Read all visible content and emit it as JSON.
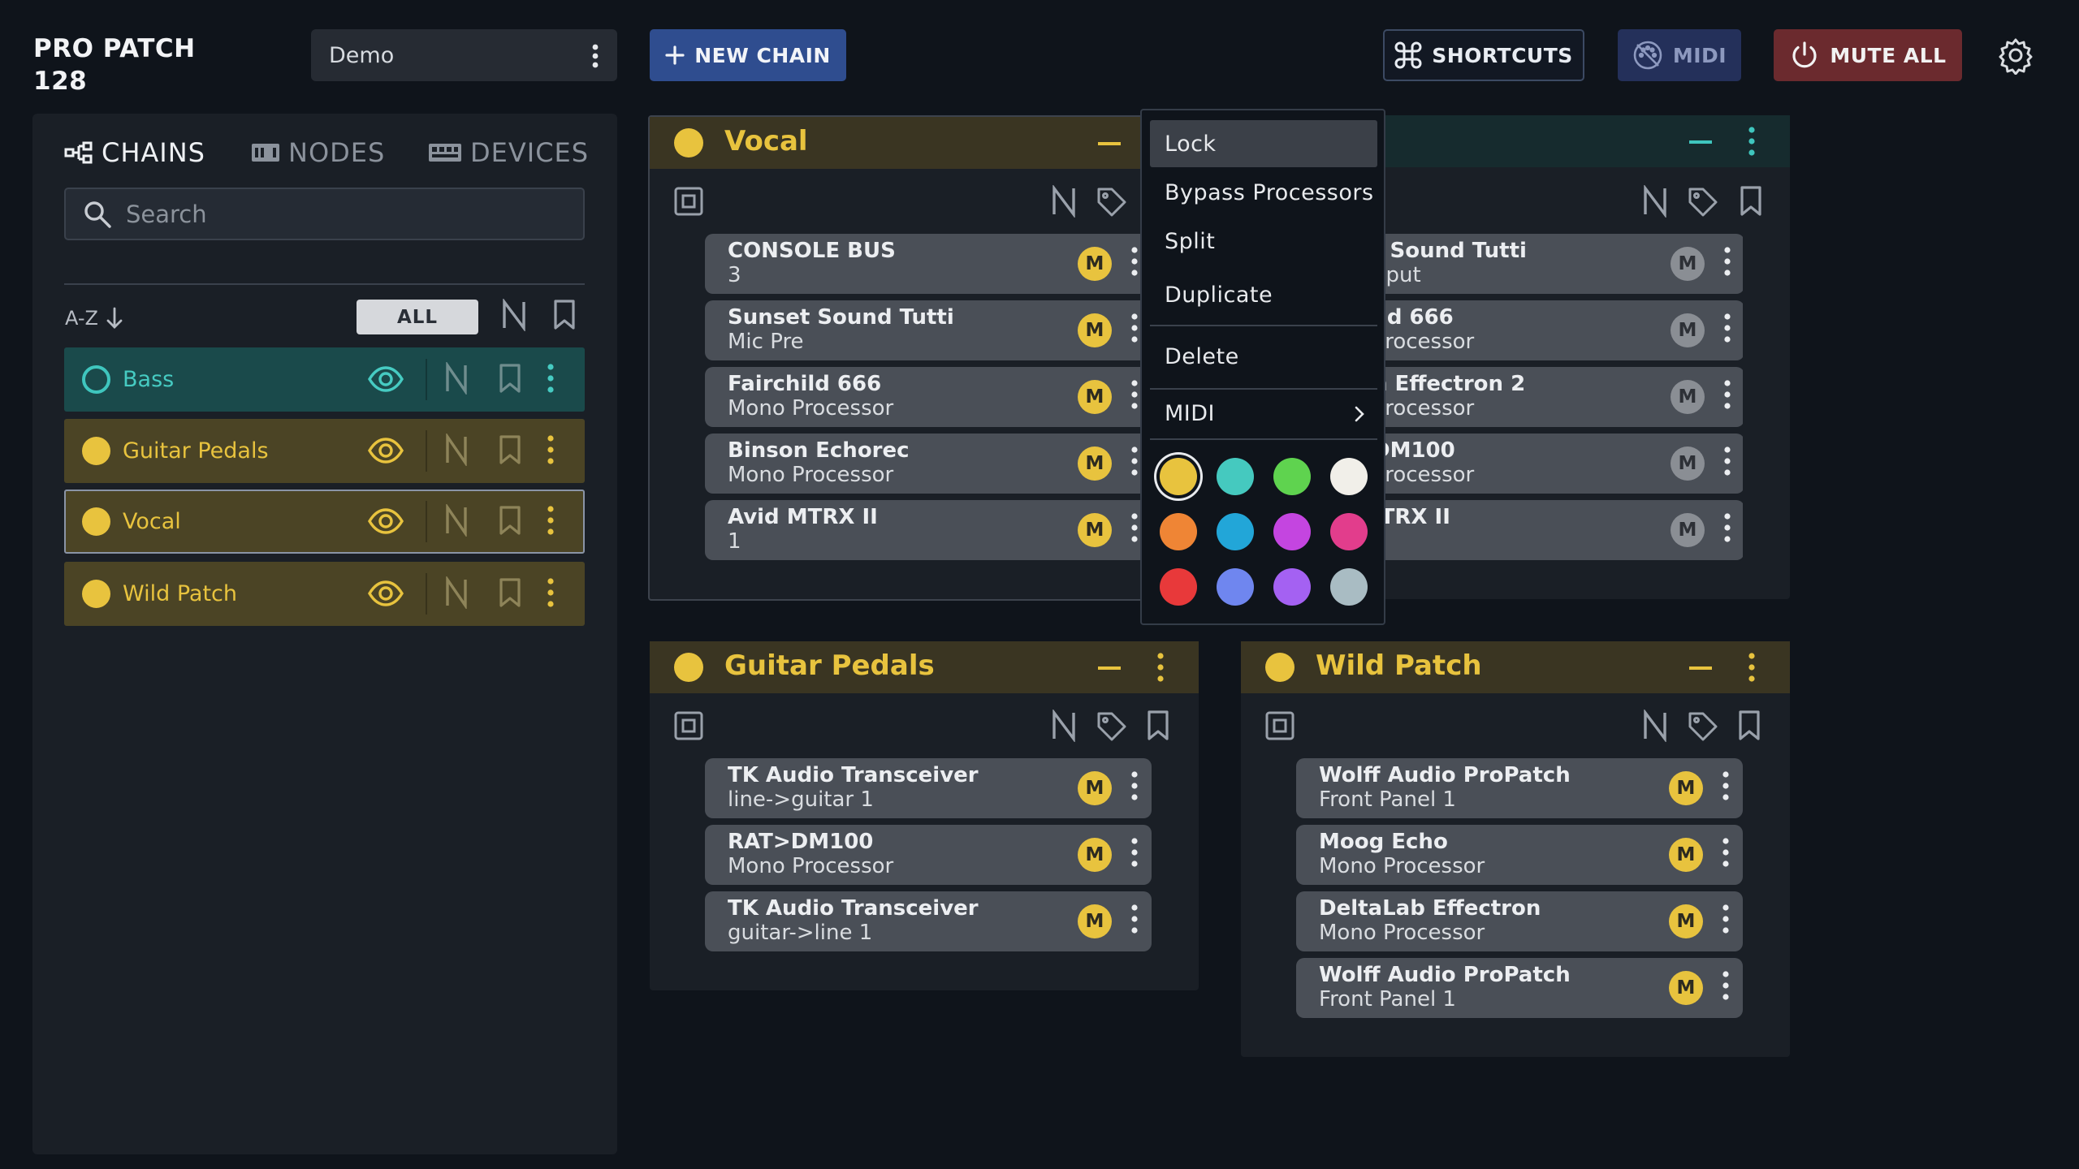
{
  "app": {
    "title": "PRO PATCH 128",
    "title_line1": "PRO PATCH",
    "title_line2": "128"
  },
  "header": {
    "project": "Demo",
    "new_chain": "NEW CHAIN",
    "shortcuts": "SHORTCUTS",
    "midi": "MIDI",
    "mute_all": "MUTE ALL"
  },
  "sidebar": {
    "tabs": [
      {
        "label": "CHAINS",
        "active": true
      },
      {
        "label": "NODES",
        "active": false
      },
      {
        "label": "DEVICES",
        "active": false
      }
    ],
    "search_placeholder": "Search",
    "sort_label": "A-Z",
    "filter_all": "ALL",
    "chains": [
      {
        "name": "Bass",
        "color": "#3fc6be",
        "style": "teal",
        "dot": "ring"
      },
      {
        "name": "Guitar Pedals",
        "color": "#e8c33e",
        "style": "gold"
      },
      {
        "name": "Vocal",
        "color": "#e8c33e",
        "style": "gold",
        "selected": true
      },
      {
        "name": "Wild Patch",
        "color": "#e8c33e",
        "style": "gold"
      }
    ]
  },
  "panels": {
    "vocal": {
      "title": "Vocal",
      "nodes": [
        {
          "name": "CONSOLE BUS",
          "sub": "3",
          "badge": "M"
        },
        {
          "name": "Sunset Sound Tutti",
          "sub": "Mic Pre",
          "badge": "M"
        },
        {
          "name": "Fairchild 666",
          "sub": "Mono Processor",
          "badge": "M"
        },
        {
          "name": "Binson Echorec",
          "sub": "Mono Processor",
          "badge": "M"
        },
        {
          "name": "Avid MTRX II",
          "sub": "1",
          "badge": "M"
        }
      ]
    },
    "bass": {
      "nodes": [
        {
          "name": "t Sound Tutti",
          "sub": "nput",
          "badge": "M"
        },
        {
          "name": "ild 666",
          "sub": "Processor",
          "badge": "M"
        },
        {
          "name": "n Effectron 2",
          "sub": "Processor",
          "badge": "M"
        },
        {
          "name": "DM100",
          "sub": "Processor",
          "badge": "M"
        },
        {
          "name": "ITRX II",
          "sub": "",
          "badge": "M"
        }
      ]
    },
    "guitar": {
      "title": "Guitar Pedals",
      "nodes": [
        {
          "name": "TK Audio Transceiver",
          "sub": "line->guitar 1",
          "badge": "M"
        },
        {
          "name": "RAT>DM100",
          "sub": "Mono Processor",
          "badge": "M"
        },
        {
          "name": "TK Audio Transceiver",
          "sub": "guitar->line 1",
          "badge": "M"
        }
      ]
    },
    "wild": {
      "title": "Wild Patch",
      "nodes": [
        {
          "name": "Wolff Audio ProPatch",
          "sub": "Front Panel 1",
          "badge": "M"
        },
        {
          "name": "Moog Echo",
          "sub": "Mono Processor",
          "badge": "M"
        },
        {
          "name": "DeltaLab Effectron",
          "sub": "Mono Processor",
          "badge": "M"
        },
        {
          "name": "Wolff Audio ProPatch",
          "sub": "Front Panel 1",
          "badge": "M"
        }
      ]
    }
  },
  "context_menu": {
    "items": [
      "Lock",
      "Bypass Processors",
      "Split",
      "Duplicate",
      "Delete",
      "MIDI"
    ],
    "swatches": [
      "#e8c33e",
      "#45c9bf",
      "#5fd34f",
      "#f1efe9",
      "#ef8535",
      "#22a6d8",
      "#c445e0",
      "#e23d8c",
      "#e8393a",
      "#6f86ef",
      "#a461f2",
      "#a9bcc3"
    ],
    "selected_swatch": 0
  },
  "icons": {
    "new_chain": "plus-icon",
    "shortcuts": "command-icon",
    "midi": "midi-off-icon",
    "mute_all": "power-icon",
    "settings": "gear-icon"
  }
}
